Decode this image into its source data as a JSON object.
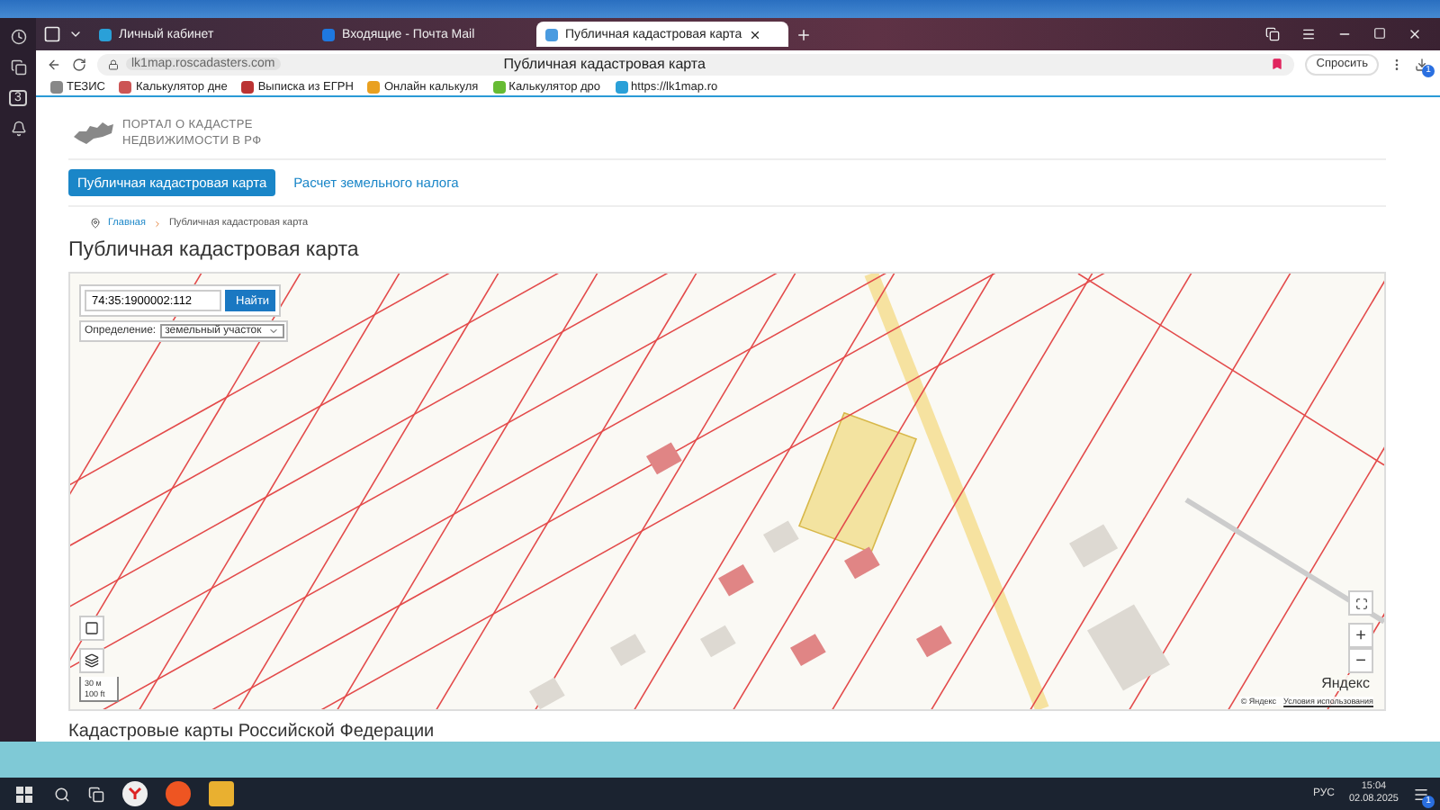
{
  "browser": {
    "tabs": [
      {
        "title": "Личный кабинет",
        "selected": false
      },
      {
        "title": "Входящие - Почта Mail",
        "selected": false
      },
      {
        "title": "Публичная кадастровая карта",
        "selected": true
      }
    ],
    "url": "lk1map.roscadasters.com",
    "page_title": "Публичная кадастровая карта",
    "ask_button": "Спросить",
    "download_badge": "1",
    "bookmarks": [
      "ТЕЗИС",
      "Калькулятор дне",
      "Выписка из ЕГРН",
      "Онлайн калькуля",
      "Калькулятор дро",
      "https://lk1map.ro"
    ],
    "sidebar_badge": "3"
  },
  "site": {
    "logo_lines": [
      "ПОРТАЛ О КАДАСТРЕ",
      "НЕДВИЖИМОСТИ В РФ"
    ],
    "nav": [
      {
        "label": "Публичная кадастровая карта",
        "selected": true
      },
      {
        "label": "Расчет земельного налога",
        "selected": false
      }
    ],
    "breadcrumb": [
      "Главная",
      "Публичная кадастровая карта"
    ],
    "title": "Публичная кадастровая карта",
    "map": {
      "search_value": "74:35:1900002:112",
      "search_button": "Найти",
      "definition_label": "Определение:",
      "definition_value": "земельный участок",
      "scale": [
        "30 м",
        "100 ft"
      ],
      "provider_logo": "Яндекс",
      "copyright": "© Яндекс",
      "terms_link": "Условия использования",
      "zoom_in": "+",
      "zoom_out": "−"
    },
    "section_heading": "Кадастровые карты Российской Федерации"
  },
  "taskbar": {
    "language": "РУС",
    "time": "15:04",
    "date": "02.08.2025",
    "notifications": "1"
  }
}
